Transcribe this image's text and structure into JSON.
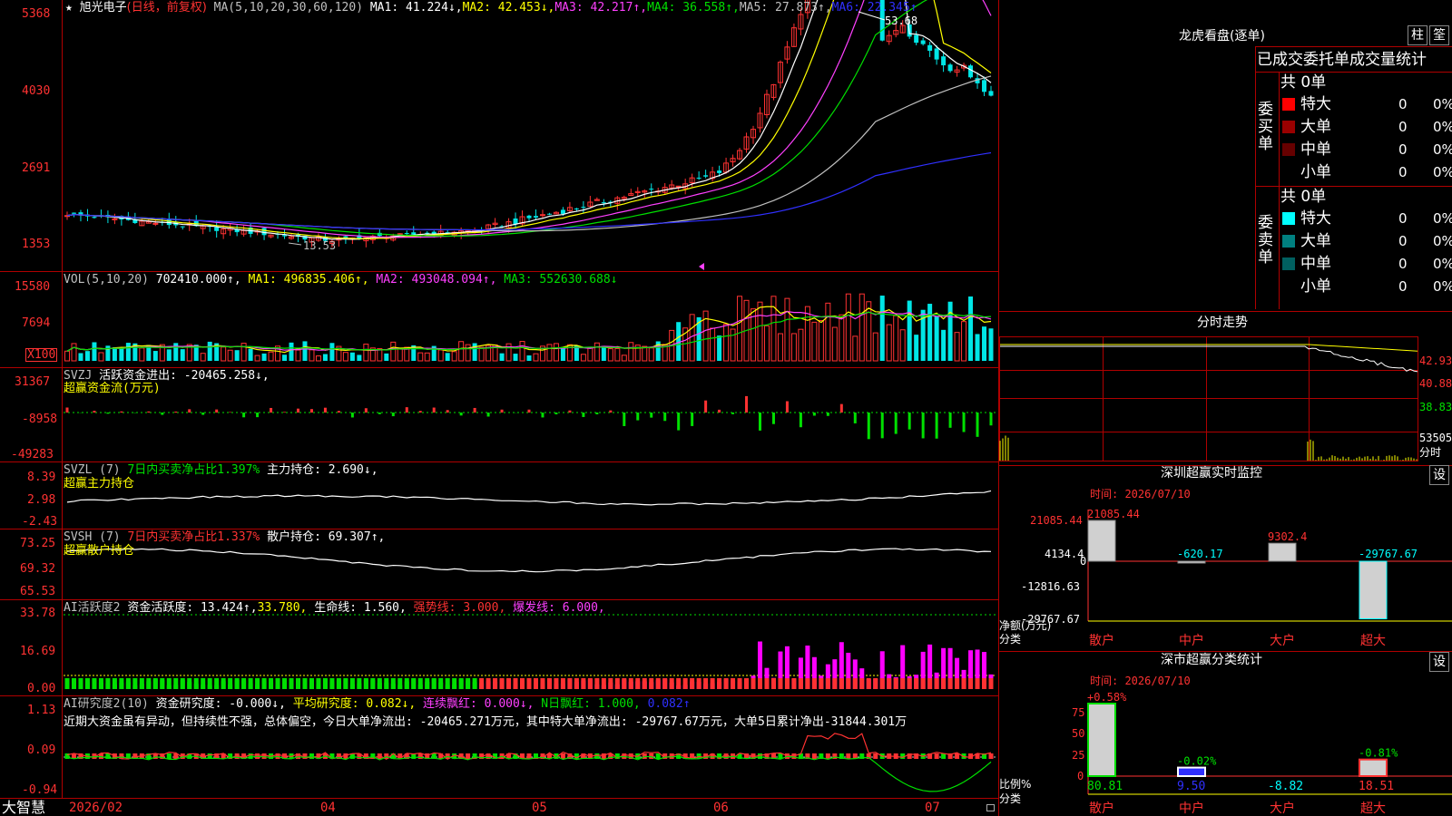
{
  "chart": {
    "title_star": "★",
    "stock_name": "旭光电子",
    "period_label": "(日线，前复权)",
    "ma_params": "MA(5,10,20,30,60,120)",
    "ma1": "MA1: 41.224↓,",
    "ma2": "MA2: 42.453↓,",
    "ma3": "MA3: 42.217↑,",
    "ma4": "MA4: 36.558↑,",
    "ma5": "MA5: 27.873↑,",
    "ma6": "MA6: 22.345↑",
    "price_axis": [
      "5368",
      "4030",
      "2691",
      "1353"
    ],
    "high_label": "53.68",
    "low_label": "13.53",
    "colors": {
      "up": "#ff3232",
      "down": "#00e6e6",
      "ma1": "#ffffff",
      "ma2": "#ffff00",
      "ma3": "#ff40ff",
      "ma4": "#00e000",
      "ma5": "#c0c0c0",
      "ma6": "#3030ff"
    }
  },
  "vol": {
    "header": "VOL(5,10,20)",
    "value": "702410.000↑,",
    "ma1": "MA1: 496835.406↑,",
    "ma2": "MA2: 493048.094↑,",
    "ma3": "MA3: 552630.688↓",
    "axis": [
      "15580",
      "7694",
      "X100"
    ]
  },
  "svzj": {
    "header": "SVZJ",
    "label": "活跃资金进出: -20465.258↓,",
    "sub": "超赢资金流(万元)",
    "axis": [
      "31367",
      "-8958",
      "-49283"
    ]
  },
  "svzl": {
    "header": "SVZL (7)",
    "label1": "7日内买卖净占比1.397%",
    "label2": "主力持仓: 2.690↓,",
    "sub": "超赢主力持仓",
    "axis": [
      "8.39",
      "2.98",
      "-2.43"
    ]
  },
  "svsh": {
    "header": "SVSH (7)",
    "label1": "7日内买卖净占比1.337%",
    "label2": "散户持仓: 69.307↑,",
    "sub": "超赢散户持仓",
    "axis": [
      "73.25",
      "69.32",
      "65.53"
    ]
  },
  "ai1": {
    "header": "AI活跃度2",
    "v1": "资金活跃度: 13.424↑,",
    "v2": "33.780,",
    "v3": "生命线: 1.560,",
    "v4": "强势线: 3.000,",
    "v5": "爆发线: 6.000,",
    "axis": [
      "33.78",
      "16.69",
      "0.00"
    ]
  },
  "ai2": {
    "header": "AI研究度2(10)",
    "v1": "资金研究度: -0.000↓,",
    "v2": "平均研究度: 0.082↓,",
    "v3": "连续飘红: 0.000↓,",
    "v4": "N日飘红: 1.000,",
    "v5": "0.082↑",
    "comment": "近期大资金虽有异动，但持续性不强，总体偏空，今日大单净流出: -20465.271万元，其中特大单净流出: -29767.67万元，大单5日累计净出-31844.301万",
    "axis": [
      "1.13",
      "0.09",
      "-0.94"
    ]
  },
  "dates": [
    "2026/02",
    "04",
    "05",
    "06",
    "07"
  ],
  "brand": "大智慧",
  "lhb": {
    "title": "龙虎看盘(逐单)",
    "btn1": "柱",
    "btn2": "筌",
    "subtitle": "已成交委托单成交量统计",
    "buy_label": "委买单",
    "sell_label": "委卖单",
    "buy_total": "共 0单",
    "sell_total": "共 0单",
    "buy_rows": [
      {
        "name": "特大",
        "count": "0",
        "pct": "0%",
        "color": "#ff0000"
      },
      {
        "name": "大单",
        "count": "0",
        "pct": "0%",
        "color": "#990000"
      },
      {
        "name": "中单",
        "count": "0",
        "pct": "0%",
        "color": "#660000"
      },
      {
        "name": "小单",
        "count": "0",
        "pct": "0%",
        "color": ""
      }
    ],
    "sell_rows": [
      {
        "name": "特大",
        "count": "0",
        "pct": "0%",
        "color": "#00ffff"
      },
      {
        "name": "大单",
        "count": "0",
        "pct": "0%",
        "color": "#008080"
      },
      {
        "name": "中单",
        "count": "0",
        "pct": "0%",
        "color": "#006060"
      },
      {
        "name": "小单",
        "count": "0",
        "pct": "0%",
        "color": ""
      }
    ]
  },
  "fenshi": {
    "title": "分时走势",
    "axis": [
      "42.93",
      "40.88",
      "38.83",
      "53505",
      "分时"
    ]
  },
  "sz_monitor": {
    "title": "深圳超赢实时监控",
    "btn": "设",
    "time": "时间: 2026/07/10",
    "axis": [
      "21085.44",
      "4134.4",
      "0",
      "-12816.63",
      "-29767.67"
    ],
    "unit1": "净额(万元)",
    "unit2": "分类",
    "cats": [
      "散户",
      "中户",
      "大户",
      "超大"
    ],
    "values": [
      21085.44,
      -620.17,
      9302.4,
      -29767.67
    ],
    "labels": [
      "21085.44",
      "-620.17",
      "9302.4",
      "-29767.67"
    ]
  },
  "sz_class": {
    "title": "深市超赢分类统计",
    "btn": "设",
    "time": "时间: 2026/07/10",
    "axis": [
      "75",
      "50",
      "25",
      "0"
    ],
    "unit1": "比例%",
    "unit2": "分类",
    "cats": [
      "散户",
      "中户",
      "大户",
      "超大"
    ],
    "values": [
      80.81,
      9.5,
      -8.82,
      18.51
    ],
    "values_text": [
      "80.81",
      "9.50",
      "-8.82",
      "18.51"
    ],
    "changes": [
      "+0.58%",
      "-0.02%",
      "",
      "-0.81%"
    ]
  }
}
